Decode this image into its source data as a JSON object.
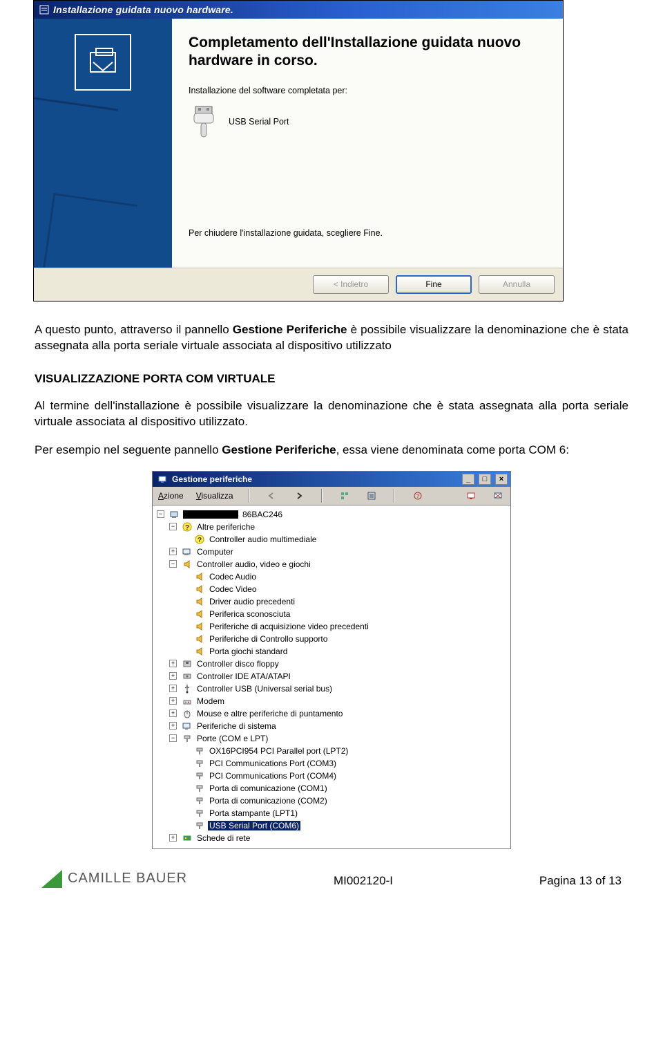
{
  "wizard": {
    "title": "Installazione guidata nuovo hardware.",
    "heading": "Completamento dell'Installazione guidata nuovo hardware in corso.",
    "completed_for": "Installazione del software completata per:",
    "device_name": "USB Serial Port",
    "close_hint": "Per chiudere l'installazione guidata, scegliere Fine.",
    "buttons": {
      "back": "< Indietro",
      "finish": "Fine",
      "cancel": "Annulla"
    }
  },
  "doc": {
    "para1_a": "A questo punto, attraverso il pannello ",
    "para1_b_bold": "Gestione Periferiche",
    "para1_c": " è possibile visualizzare la denominazione che è stata assegnata alla porta seriale virtuale associata al dispositivo utilizzato",
    "h2": "VISUALIZZAZIONE PORTA COM VIRTUALE",
    "para2": "Al termine dell'installazione è possibile visualizzare la denominazione che è stata assegnata alla porta seriale virtuale associata al dispositivo utilizzato.",
    "para3_a": "Per esempio nel seguente pannello ",
    "para3_b_bold": "Gestione Periferiche",
    "para3_c": ", essa viene denominata come porta COM 6:"
  },
  "devmgr": {
    "title": "Gestione periferiche",
    "menus": {
      "azione": "Azione",
      "visualizza": "Visualizza"
    },
    "root": "86BAC246",
    "nodes": [
      {
        "level": 2,
        "exp": "-",
        "icon": "question",
        "label": "Altre periferiche"
      },
      {
        "level": 3,
        "exp": "",
        "icon": "question",
        "label": "Controller audio multimediale"
      },
      {
        "level": 2,
        "exp": "+",
        "icon": "computer",
        "label": "Computer"
      },
      {
        "level": 2,
        "exp": "-",
        "icon": "sound",
        "label": "Controller audio, video e giochi"
      },
      {
        "level": 3,
        "exp": "",
        "icon": "sound",
        "label": "Codec Audio"
      },
      {
        "level": 3,
        "exp": "",
        "icon": "sound",
        "label": "Codec Video"
      },
      {
        "level": 3,
        "exp": "",
        "icon": "sound",
        "label": "Driver audio precedenti"
      },
      {
        "level": 3,
        "exp": "",
        "icon": "sound",
        "label": "Periferica sconosciuta"
      },
      {
        "level": 3,
        "exp": "",
        "icon": "sound",
        "label": "Periferiche di acquisizione video precedenti"
      },
      {
        "level": 3,
        "exp": "",
        "icon": "sound",
        "label": "Periferiche di Controllo supporto"
      },
      {
        "level": 3,
        "exp": "",
        "icon": "sound",
        "label": "Porta giochi standard"
      },
      {
        "level": 2,
        "exp": "+",
        "icon": "floppy",
        "label": "Controller disco floppy"
      },
      {
        "level": 2,
        "exp": "+",
        "icon": "ide",
        "label": "Controller IDE ATA/ATAPI"
      },
      {
        "level": 2,
        "exp": "+",
        "icon": "usb",
        "label": "Controller USB (Universal serial bus)"
      },
      {
        "level": 2,
        "exp": "+",
        "icon": "modem",
        "label": "Modem"
      },
      {
        "level": 2,
        "exp": "+",
        "icon": "mouse",
        "label": "Mouse e altre periferiche di puntamento"
      },
      {
        "level": 2,
        "exp": "+",
        "icon": "system",
        "label": "Periferiche di sistema"
      },
      {
        "level": 2,
        "exp": "-",
        "icon": "port",
        "label": "Porte (COM e LPT)"
      },
      {
        "level": 3,
        "exp": "",
        "icon": "port",
        "label": "OX16PCI954 PCI Parallel port (LPT2)"
      },
      {
        "level": 3,
        "exp": "",
        "icon": "port",
        "label": "PCI Communications Port (COM3)"
      },
      {
        "level": 3,
        "exp": "",
        "icon": "port",
        "label": "PCI Communications Port (COM4)"
      },
      {
        "level": 3,
        "exp": "",
        "icon": "port",
        "label": "Porta di comunicazione (COM1)"
      },
      {
        "level": 3,
        "exp": "",
        "icon": "port",
        "label": "Porta di comunicazione (COM2)"
      },
      {
        "level": 3,
        "exp": "",
        "icon": "port",
        "label": "Porta stampante (LPT1)"
      },
      {
        "level": 3,
        "exp": "",
        "icon": "port",
        "label": "USB Serial Port (COM6)",
        "selected": true
      },
      {
        "level": 2,
        "exp": "+",
        "icon": "network",
        "label": "Schede di rete"
      }
    ]
  },
  "footer": {
    "brand": "CAMILLE BAUER",
    "doc_id": "MI002120-I",
    "page": "Pagina 13 of 13"
  }
}
